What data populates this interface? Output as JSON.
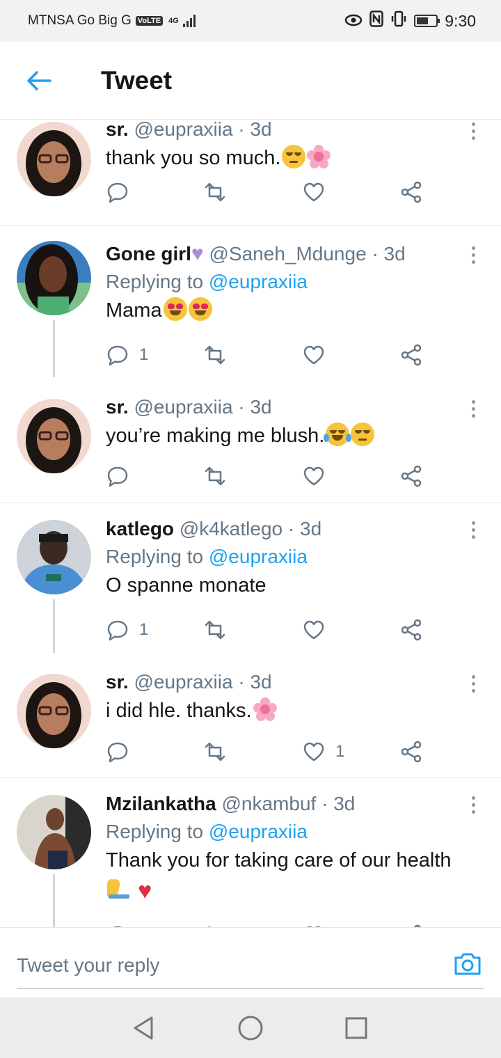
{
  "status_bar": {
    "carrier": "MTNSA Go Big G",
    "volte": "VoLTE",
    "network": "4G",
    "time": "9:30",
    "battery_level": 0.6
  },
  "header": {
    "title": "Tweet",
    "back_icon": "arrow-left-icon"
  },
  "colors": {
    "accent": "#1da1f2",
    "secondary_text": "#657786",
    "divider": "#e1e8ed"
  },
  "tweets": [
    {
      "name": "sr.",
      "handle": "@eupraxiia",
      "time": "3d",
      "reply_to": "",
      "text": "thank you so much.",
      "reply_count": "",
      "like_count": ""
    },
    {
      "name": "Gone girl",
      "handle": "@Saneh_Mdunge",
      "time": "3d",
      "reply_to_label": "Replying to",
      "reply_to": "@eupraxiia",
      "text": "Mama",
      "reply_count": "1",
      "like_count": ""
    },
    {
      "name": "sr.",
      "handle": "@eupraxiia",
      "time": "3d",
      "reply_to": "",
      "text": "you’re making me blush.",
      "reply_count": "",
      "like_count": ""
    },
    {
      "name": "katlego",
      "handle": "@k4katlego",
      "time": "3d",
      "reply_to_label": "Replying to",
      "reply_to": "@eupraxiia",
      "text": "O spanne monate",
      "reply_count": "1",
      "like_count": ""
    },
    {
      "name": "sr.",
      "handle": "@eupraxiia",
      "time": "3d",
      "reply_to": "",
      "text": "i did hle. thanks.",
      "reply_count": "",
      "like_count": "1"
    },
    {
      "name": "Mzilankatha",
      "handle": "@nkambuf",
      "time": "3d",
      "reply_to_label": "Replying to",
      "reply_to": "@eupraxiia",
      "text": "Thank you for taking care of our health",
      "reply_count": "",
      "like_count": ""
    }
  ],
  "composer": {
    "placeholder": "Tweet your reply",
    "camera_icon": "camera-icon"
  },
  "nav": {
    "back_icon": "triangle-back-icon",
    "home_icon": "circle-home-icon",
    "recents_icon": "square-recents-icon"
  }
}
